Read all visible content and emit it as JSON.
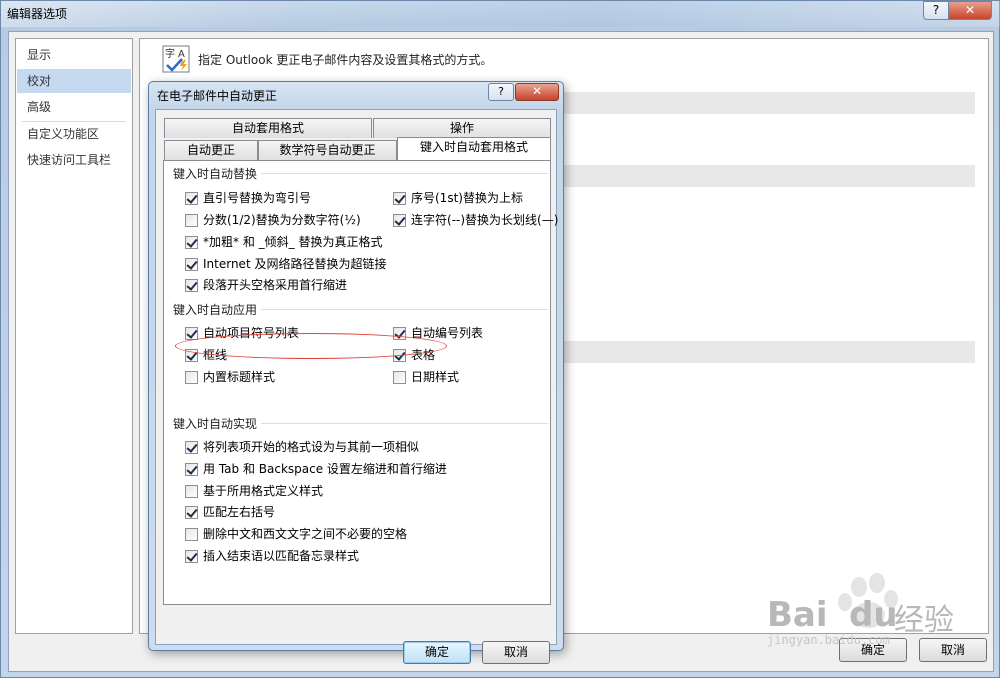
{
  "outer": {
    "title": "编辑器选项",
    "help_glyph": "?",
    "close_glyph": "✕",
    "nav_items": [
      {
        "label": "显示"
      },
      {
        "label": "校对"
      },
      {
        "label": "高级"
      },
      {
        "label": "自定义功能区"
      },
      {
        "label": "快速访问工具栏"
      }
    ],
    "selected_nav": "校对",
    "proofing_description": "指定 Outlook 更正电子邮件内容及设置其格式的方式。",
    "ok_label": "确定",
    "cancel_label": "取消"
  },
  "dialog": {
    "title": "在电子邮件中自动更正",
    "help_glyph": "?",
    "close_glyph": "✕",
    "tabs_back": [
      {
        "label": "自动套用格式"
      },
      {
        "label": "操作"
      }
    ],
    "tabs_front": [
      {
        "label": "自动更正"
      },
      {
        "label": "数学符号自动更正"
      },
      {
        "label": "键入时自动套用格式"
      }
    ],
    "active_tab": "键入时自动套用格式",
    "groups": {
      "replace": {
        "label": "键入时自动替换",
        "options": [
          {
            "label": "直引号替换为弯引号",
            "checked": true
          },
          {
            "label": "序号(1st)替换为上标",
            "checked": true
          },
          {
            "label": "分数(1/2)替换为分数字符(½)",
            "checked": false
          },
          {
            "label": "连字符(--)替换为长划线(—)",
            "checked": true
          },
          {
            "label": "*加粗* 和 _倾斜_ 替换为真正格式",
            "checked": true
          },
          {
            "label": "Internet 及网络路径替换为超链接",
            "checked": true
          },
          {
            "label": "段落开头空格采用首行缩进",
            "checked": true
          }
        ]
      },
      "apply": {
        "label": "键入时自动应用",
        "options": [
          {
            "label": "自动项目符号列表",
            "checked": true
          },
          {
            "label": "自动编号列表",
            "checked": true
          },
          {
            "label": "框线",
            "checked": true
          },
          {
            "label": "表格",
            "checked": true
          },
          {
            "label": "内置标题样式",
            "checked": false
          },
          {
            "label": "日期样式",
            "checked": false
          }
        ]
      },
      "auto": {
        "label": "键入时自动实现",
        "options": [
          {
            "label": "将列表项开始的格式设为与其前一项相似",
            "checked": true
          },
          {
            "label": "用 Tab 和 Backspace 设置左缩进和首行缩进",
            "checked": true
          },
          {
            "label": "基于所用格式定义样式",
            "checked": false
          },
          {
            "label": "匹配左右括号",
            "checked": true
          },
          {
            "label": "删除中文和西文文字之间不必要的空格",
            "checked": false
          },
          {
            "label": "插入结束语以匹配备忘录样式",
            "checked": true
          }
        ]
      }
    },
    "ok_label": "确定",
    "cancel_label": "取消"
  },
  "watermark": {
    "brand": "Bai",
    "brand2": "du",
    "brand_cn": "经验",
    "url": "jingyan.baidu.com"
  },
  "colors": {
    "selection": "#c5d9f1",
    "annotation_oval": "#e0443a",
    "title_gradient_top": "#d7e4f2"
  }
}
